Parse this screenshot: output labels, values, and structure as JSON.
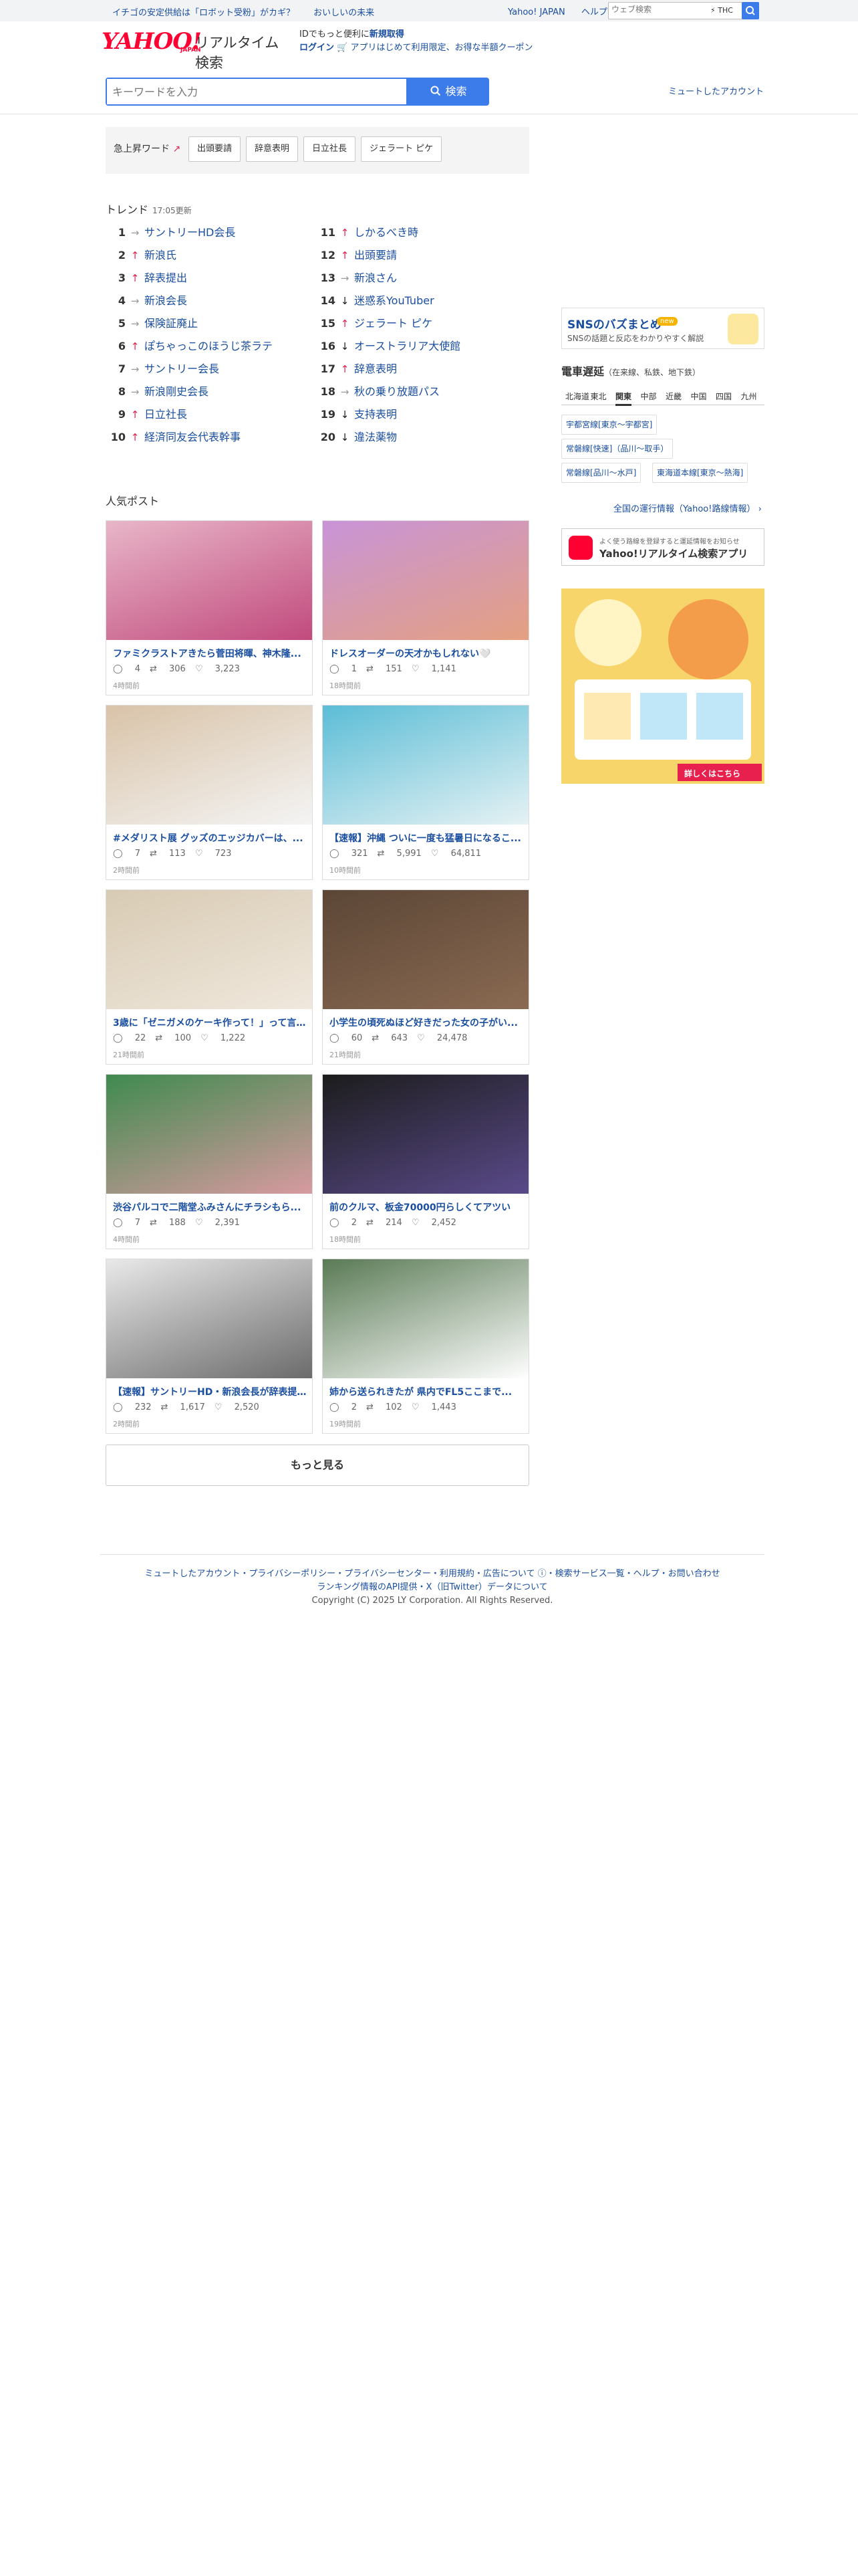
{
  "topbar": {
    "news1": "イチゴの安定供給は「ロボット受粉」がカギ？",
    "news2": "おいしいの未来",
    "yahoo_japan": "Yahoo! JAPAN",
    "help": "ヘルプ",
    "websearch_placeholder": "ウェブ検索",
    "thc": "THC"
  },
  "header": {
    "logo": "YAHOO!",
    "logo_sub": "JAPAN",
    "service_name": "リアルタイム検索",
    "promo1_pre": "IDでもっと便利に",
    "promo1_link": "新規取得",
    "promo2_link": "ログイン",
    "promo2_text": "🛒 アプリはじめて利用限定、お得な半額クーポン",
    "search_placeholder": "キーワードを入力",
    "search_button": "検索",
    "muted_accounts": "ミュートしたアカウント"
  },
  "rising": {
    "label": "急上昇ワード",
    "words": [
      "出頭要請",
      "辞意表明",
      "日立社長",
      "ジェラート ピケ"
    ]
  },
  "trend": {
    "title": "トレンド",
    "updated": "17:05更新",
    "items": [
      {
        "rank": "1",
        "dir": "eq",
        "text": "サントリーHD会長"
      },
      {
        "rank": "2",
        "dir": "up",
        "text": "新浪氏"
      },
      {
        "rank": "3",
        "dir": "up",
        "text": "辞表提出"
      },
      {
        "rank": "4",
        "dir": "eq",
        "text": "新浪会長"
      },
      {
        "rank": "5",
        "dir": "eq",
        "text": "保険証廃止"
      },
      {
        "rank": "6",
        "dir": "up",
        "text": "ぽちゃっこのほうじ茶ラテ"
      },
      {
        "rank": "7",
        "dir": "eq",
        "text": "サントリー会長"
      },
      {
        "rank": "8",
        "dir": "eq",
        "text": "新浪剛史会長"
      },
      {
        "rank": "9",
        "dir": "up",
        "text": "日立社長"
      },
      {
        "rank": "10",
        "dir": "up",
        "text": "経済同友会代表幹事"
      },
      {
        "rank": "11",
        "dir": "up",
        "text": "しかるべき時"
      },
      {
        "rank": "12",
        "dir": "up",
        "text": "出頭要請"
      },
      {
        "rank": "13",
        "dir": "eq",
        "text": "新浪さん"
      },
      {
        "rank": "14",
        "dir": "dn",
        "text": "迷惑系YouTuber"
      },
      {
        "rank": "15",
        "dir": "up",
        "text": "ジェラート ピケ"
      },
      {
        "rank": "16",
        "dir": "dn",
        "text": "オーストラリア大使館"
      },
      {
        "rank": "17",
        "dir": "up",
        "text": "辞意表明"
      },
      {
        "rank": "18",
        "dir": "eq",
        "text": "秋の乗り放題パス"
      },
      {
        "rank": "19",
        "dir": "dn",
        "text": "支持表明"
      },
      {
        "rank": "20",
        "dir": "dn",
        "text": "違法薬物"
      }
    ]
  },
  "popular": {
    "title": "人気ポスト",
    "more": "もっと見る",
    "posts": [
      {
        "title": "ファミクラストアきたら菅田将暉、神木隆...",
        "replies": "4",
        "reposts": "306",
        "likes": "3,223",
        "ago": "4時間前"
      },
      {
        "title": "ドレスオーダーの天才かもしれない🤍",
        "replies": "1",
        "reposts": "151",
        "likes": "1,141",
        "ago": "18時間前"
      },
      {
        "title": "#メダリスト展 グッズのエッジカバーは、...",
        "replies": "7",
        "reposts": "113",
        "likes": "723",
        "ago": "2時間前"
      },
      {
        "title": "【速報】沖縄 ついに一度も猛暑日になるこ...",
        "replies": "321",
        "reposts": "5,991",
        "likes": "64,811",
        "ago": "10時間前"
      },
      {
        "title": "3歳に「ゼニガメのケーキ作って！」って言わ...",
        "replies": "22",
        "reposts": "100",
        "likes": "1,222",
        "ago": "21時間前"
      },
      {
        "title": "小学生の頃死ぬほど好きだった女の子がい...",
        "replies": "60",
        "reposts": "643",
        "likes": "24,478",
        "ago": "21時間前"
      },
      {
        "title": "渋谷パルコで二階堂ふみさんにチラシもら...",
        "replies": "7",
        "reposts": "188",
        "likes": "2,391",
        "ago": "4時間前"
      },
      {
        "title": "前のクルマ、板金70000円らしくてアツい",
        "replies": "2",
        "reposts": "214",
        "likes": "2,452",
        "ago": "18時間前"
      },
      {
        "title": "【速報】サントリーHD・新浪会長が辞表提...",
        "replies": "232",
        "reposts": "1,617",
        "likes": "2,520",
        "ago": "2時間前"
      },
      {
        "title": "姉から送られきたが 県内でFL5ここまで...",
        "replies": "2",
        "reposts": "102",
        "likes": "1,443",
        "ago": "19時間前"
      }
    ]
  },
  "sidebar": {
    "sns_title": "SNSのバズまとめ",
    "sns_new": "new",
    "sns_sub": "SNSの話題と反応をわかりやすく解説",
    "train_title": "電車遅延",
    "train_sub": "（在来線、私鉄、地下鉄）",
    "regions": [
      "北海道",
      "東北",
      "関東",
      "中部",
      "近畿",
      "中国",
      "四国",
      "九州"
    ],
    "selected_region": "関東",
    "lines": [
      "宇都宮線[東京〜宇都宮]",
      "常磐線[快速]（品川〜取手）",
      "常磐線[品川〜水戸]",
      "東海道本線[東京〜熱海]"
    ],
    "all_train": "全国の運行情報（Yahoo!路線情報）",
    "app_small": "よく使う路線を登録すると運延情報をお知らせ",
    "app_large": "Yahoo!リアルタイム検索アプリ",
    "ad_cta": "詳しくはこちら"
  },
  "footer": {
    "links": "ミュートしたアカウント・プライバシーポリシー・プライバシーセンター・利用規約・広告について ⓘ・検索サービス一覧・ヘルプ・お問い合わせ",
    "links2": "ランキング情報のAPI提供・X（旧Twitter）データについて",
    "copyright": "Copyright (C) 2025 LY Corporation. All Rights Reserved."
  },
  "colors": {
    "accent": "#3b7bea",
    "link": "#1a4ea0",
    "up": "#e8204d",
    "brand": "#ff0033"
  }
}
